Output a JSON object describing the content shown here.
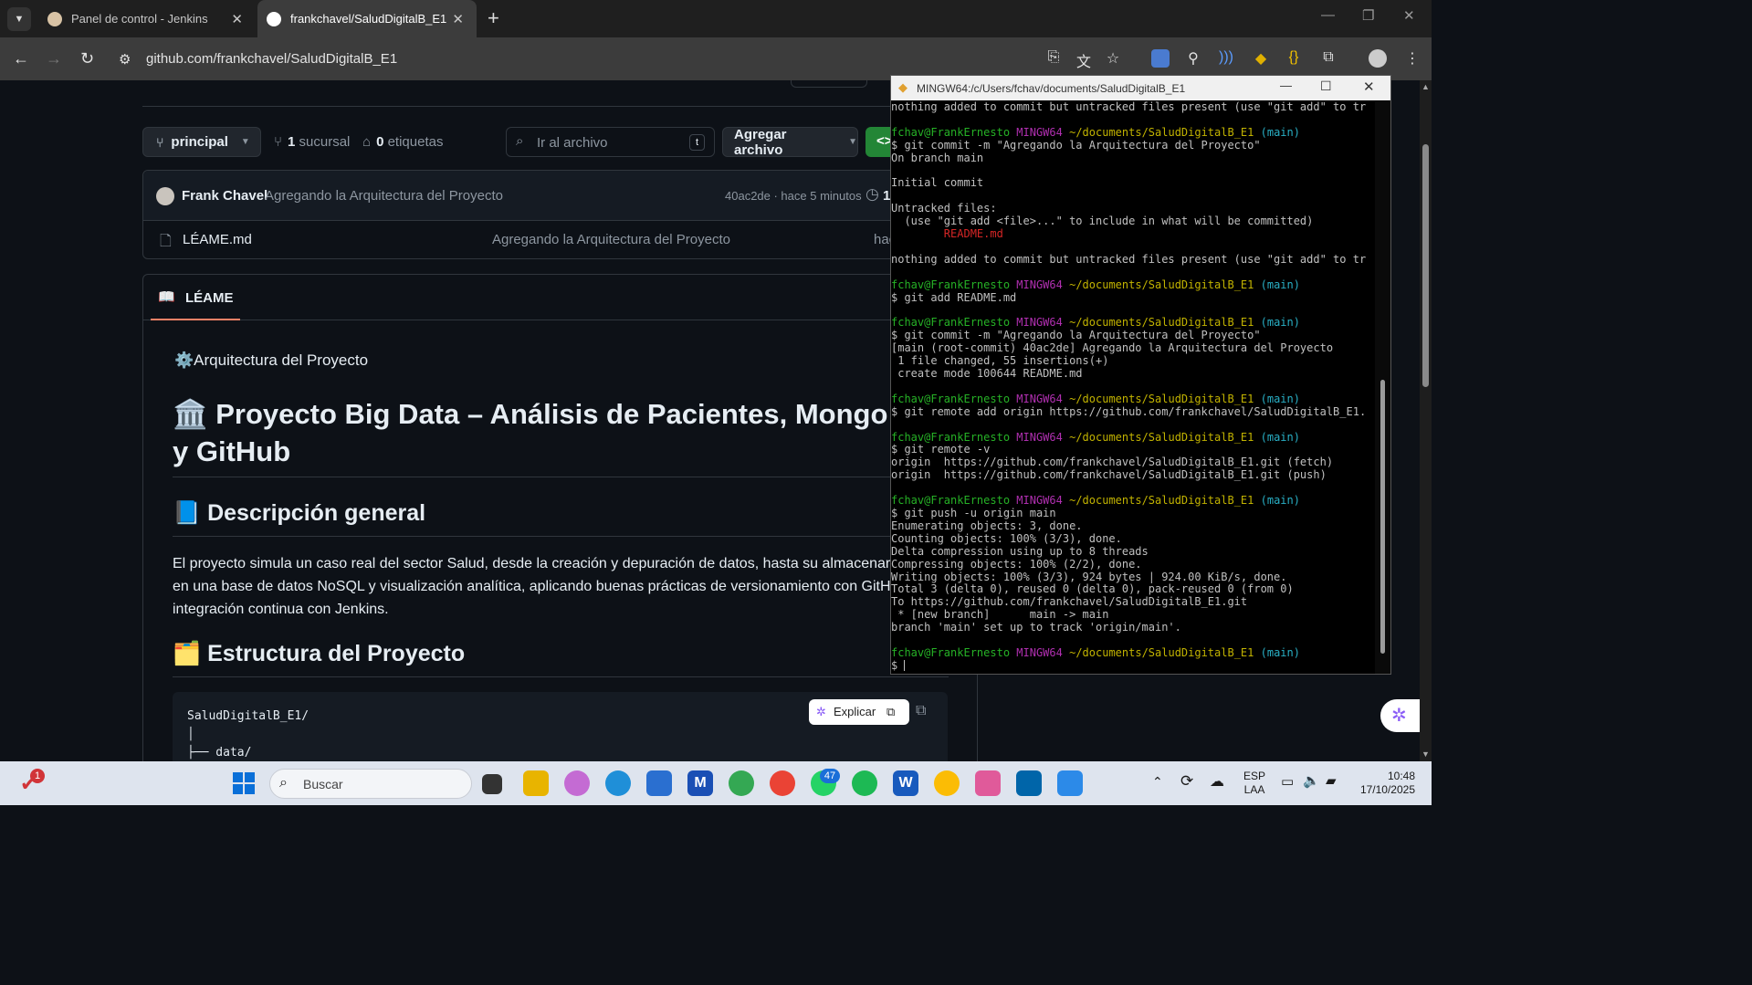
{
  "browser": {
    "tabs": [
      {
        "label": "Panel de control - Jenkins"
      },
      {
        "label": "frankchavel/SaludDigitalB_E1"
      }
    ],
    "new_tab": "+",
    "url": "github.com/frankchavel/SaludDigitalB_E1"
  },
  "repo": {
    "branch": "principal",
    "branches_count": "1",
    "branches_label": "sucursal",
    "tags_count": "0",
    "tags_label": "etiquetas",
    "goto_file_placeholder": "Ir al archivo",
    "goto_file_key": "t",
    "add_file": "Agregar archivo",
    "commit": {
      "author": "Frank Chavel",
      "message": "Agregando la Arquitectura del Proyecto",
      "meta": "40ac2de · hace 5 minutos",
      "count": "1"
    },
    "files": [
      {
        "name": "LÉAME.md",
        "message": "Agregando la Arquitectura del Proyecto",
        "time": "hac"
      }
    ],
    "readme_tab": "LÉAME"
  },
  "readme": {
    "arch_line": "⚙️Arquitectura del Proyecto",
    "title_emoji": "🏛️",
    "title": "Proyecto Big Data – Análisis de Pacientes, Mongo",
    "title_cont": "y GitHub",
    "h2_desc_emoji": "📘",
    "h2_desc": "Descripción general",
    "desc_lines": [
      "El proyecto simula un caso real del sector Salud, desde la creación y depuración de datos, hasta su almacenar",
      "en una base de datos NoSQL y visualización analítica, aplicando buenas prácticas de versionamiento con GitH",
      "integración continua con Jenkins."
    ],
    "h2_struct_emoji": "🗂️",
    "h2_struct": "Estructura del Proyecto",
    "code_lines": [
      "SaludDigitalB_E1/",
      "│",
      "├── data/"
    ],
    "explain_btn": "Explicar"
  },
  "terminal": {
    "title": "MINGW64:/c/Users/fchav/documents/SaludDigitalB_E1",
    "user": "fchav@FrankErnesto",
    "env": "MINGW64",
    "path": "~/documents/SaludDigitalB_E1",
    "branch": "(main)",
    "lines": {
      "l0": "nothing added to commit but untracked files present (use \"git add\" to tr",
      "l1": "$ git commit -m \"Agregando la Arquitectura del Proyecto\"",
      "l2": "On branch main",
      "l3": "Initial commit",
      "l4": "Untracked files:",
      "l5": "  (use \"git add <file>...\" to include in what will be committed)",
      "l6": "        README.md",
      "l7": "nothing added to commit but untracked files present (use \"git add\" to tr",
      "l8": "$ git add README.md",
      "l9": "$ git commit -m \"Agregando la Arquitectura del Proyecto\"",
      "l10": "[main (root-commit) 40ac2de] Agregando la Arquitectura del Proyecto",
      "l11": " 1 file changed, 55 insertions(+)",
      "l12": " create mode 100644 README.md",
      "l13": "$ git remote add origin https://github.com/frankchavel/SaludDigitalB_E1.",
      "l14": "$ git remote -v",
      "l15": "origin  https://github.com/frankchavel/SaludDigitalB_E1.git (fetch)",
      "l16": "origin  https://github.com/frankchavel/SaludDigitalB_E1.git (push)",
      "l17": "$ git push -u origin main",
      "l18": "Enumerating objects: 3, done.",
      "l19": "Counting objects: 100% (3/3), done.",
      "l20": "Delta compression using up to 8 threads",
      "l21": "Compressing objects: 100% (2/2), done.",
      "l22": "Writing objects: 100% (3/3), 924 bytes | 924.00 KiB/s, done.",
      "l23": "Total 3 (delta 0), reused 0 (delta 0), pack-reused 0 (from 0)",
      "l24": "To https://github.com/frankchavel/SaludDigitalB_E1.git",
      "l25": " * [new branch]      main -> main",
      "l26": "branch 'main' set up to track 'origin/main'.",
      "l27": "$ "
    }
  },
  "taskbar": {
    "search_placeholder": "Buscar",
    "notif_badge": "1",
    "whatsapp_badge": "47",
    "lang_top": "ESP",
    "lang_bottom": "LAA",
    "time": "10:48",
    "date": "17/10/2025"
  }
}
